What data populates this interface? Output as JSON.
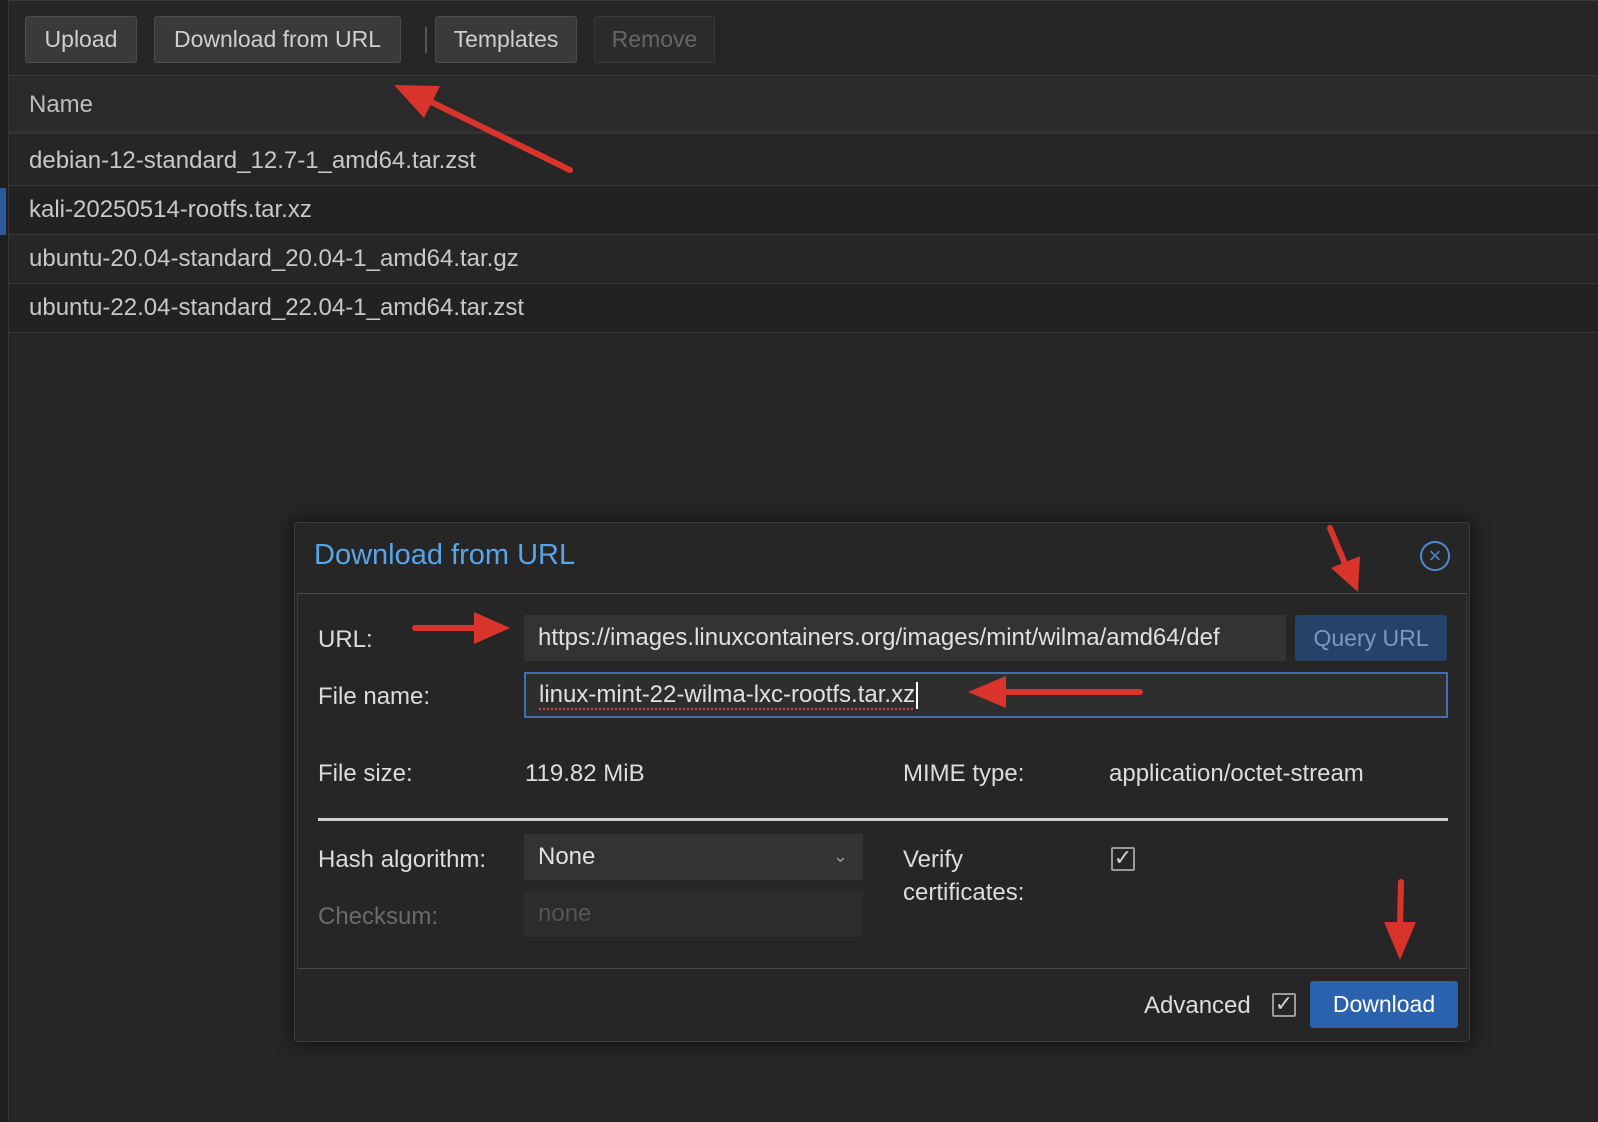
{
  "toolbar": {
    "upload": "Upload",
    "download_url": "Download from URL",
    "templates": "Templates",
    "remove": "Remove"
  },
  "grid": {
    "column_name": "Name",
    "rows": [
      "debian-12-standard_12.7-1_amd64.tar.zst",
      "kali-20250514-rootfs.tar.xz",
      "ubuntu-20.04-standard_20.04-1_amd64.tar.gz",
      "ubuntu-22.04-standard_22.04-1_amd64.tar.zst"
    ],
    "selected_row": 1
  },
  "dialog": {
    "title": "Download from URL",
    "url_label": "URL:",
    "url_value": "https://images.linuxcontainers.org/images/mint/wilma/amd64/def",
    "query_url": "Query URL",
    "filename_label": "File name:",
    "filename_value": "linux-mint-22-wilma-lxc-rootfs.tar.xz",
    "filesize_label": "File size:",
    "filesize_value": "119.82 MiB",
    "mime_label": "MIME type:",
    "mime_value": "application/octet-stream",
    "hash_label": "Hash algorithm:",
    "hash_value": "None",
    "checksum_label": "Checksum:",
    "checksum_placeholder": "none",
    "verify_label_line1": "Verify",
    "verify_label_line2": "certificates:",
    "verify_checked": true,
    "advanced_label": "Advanced",
    "advanced_checked": true,
    "download_button": "Download"
  },
  "colors": {
    "accent": "#2b62ad",
    "title": "#5aa4e8",
    "annotation_arrow": "#d9342b"
  },
  "icons": {
    "close": "close-circle-icon",
    "dropdown": "chevron-down-icon",
    "check": "checkmark-icon"
  }
}
